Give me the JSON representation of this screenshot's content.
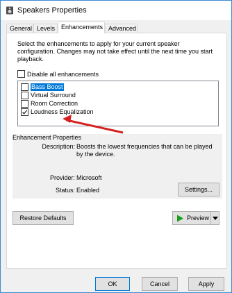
{
  "window": {
    "title": "Speakers Properties"
  },
  "tabs": [
    {
      "label": "General"
    },
    {
      "label": "Levels"
    },
    {
      "label": "Enhancements"
    },
    {
      "label": "Advanced"
    }
  ],
  "intro_text": "Select the enhancements to apply for your current speaker configuration. Changes may not take effect until the next time you start playback.",
  "disable_all": {
    "label": "Disable all enhancements",
    "checked": false
  },
  "enhancements": [
    {
      "label": "Bass Boost",
      "checked": false,
      "selected": true
    },
    {
      "label": "Virtual Surround",
      "checked": false,
      "selected": false
    },
    {
      "label": "Room Correction",
      "checked": false,
      "selected": false
    },
    {
      "label": "Loudness Equalization",
      "checked": true,
      "selected": false
    }
  ],
  "properties": {
    "group_title": "Enhancement Properties",
    "description_label": "Description:",
    "description_value": "Boosts the lowest frequencies that can be played by the device.",
    "provider_label": "Provider:",
    "provider_value": "Microsoft",
    "status_label": "Status:",
    "status_value": "Enabled",
    "settings_button": "Settings..."
  },
  "restore_defaults_button": "Restore Defaults",
  "preview_button": "Preview",
  "footer": {
    "ok": "OK",
    "cancel": "Cancel",
    "apply": "Apply"
  },
  "colors": {
    "accent": "#0078d7",
    "arrow": "#d62020",
    "preview_play": "#1a9b1a"
  }
}
